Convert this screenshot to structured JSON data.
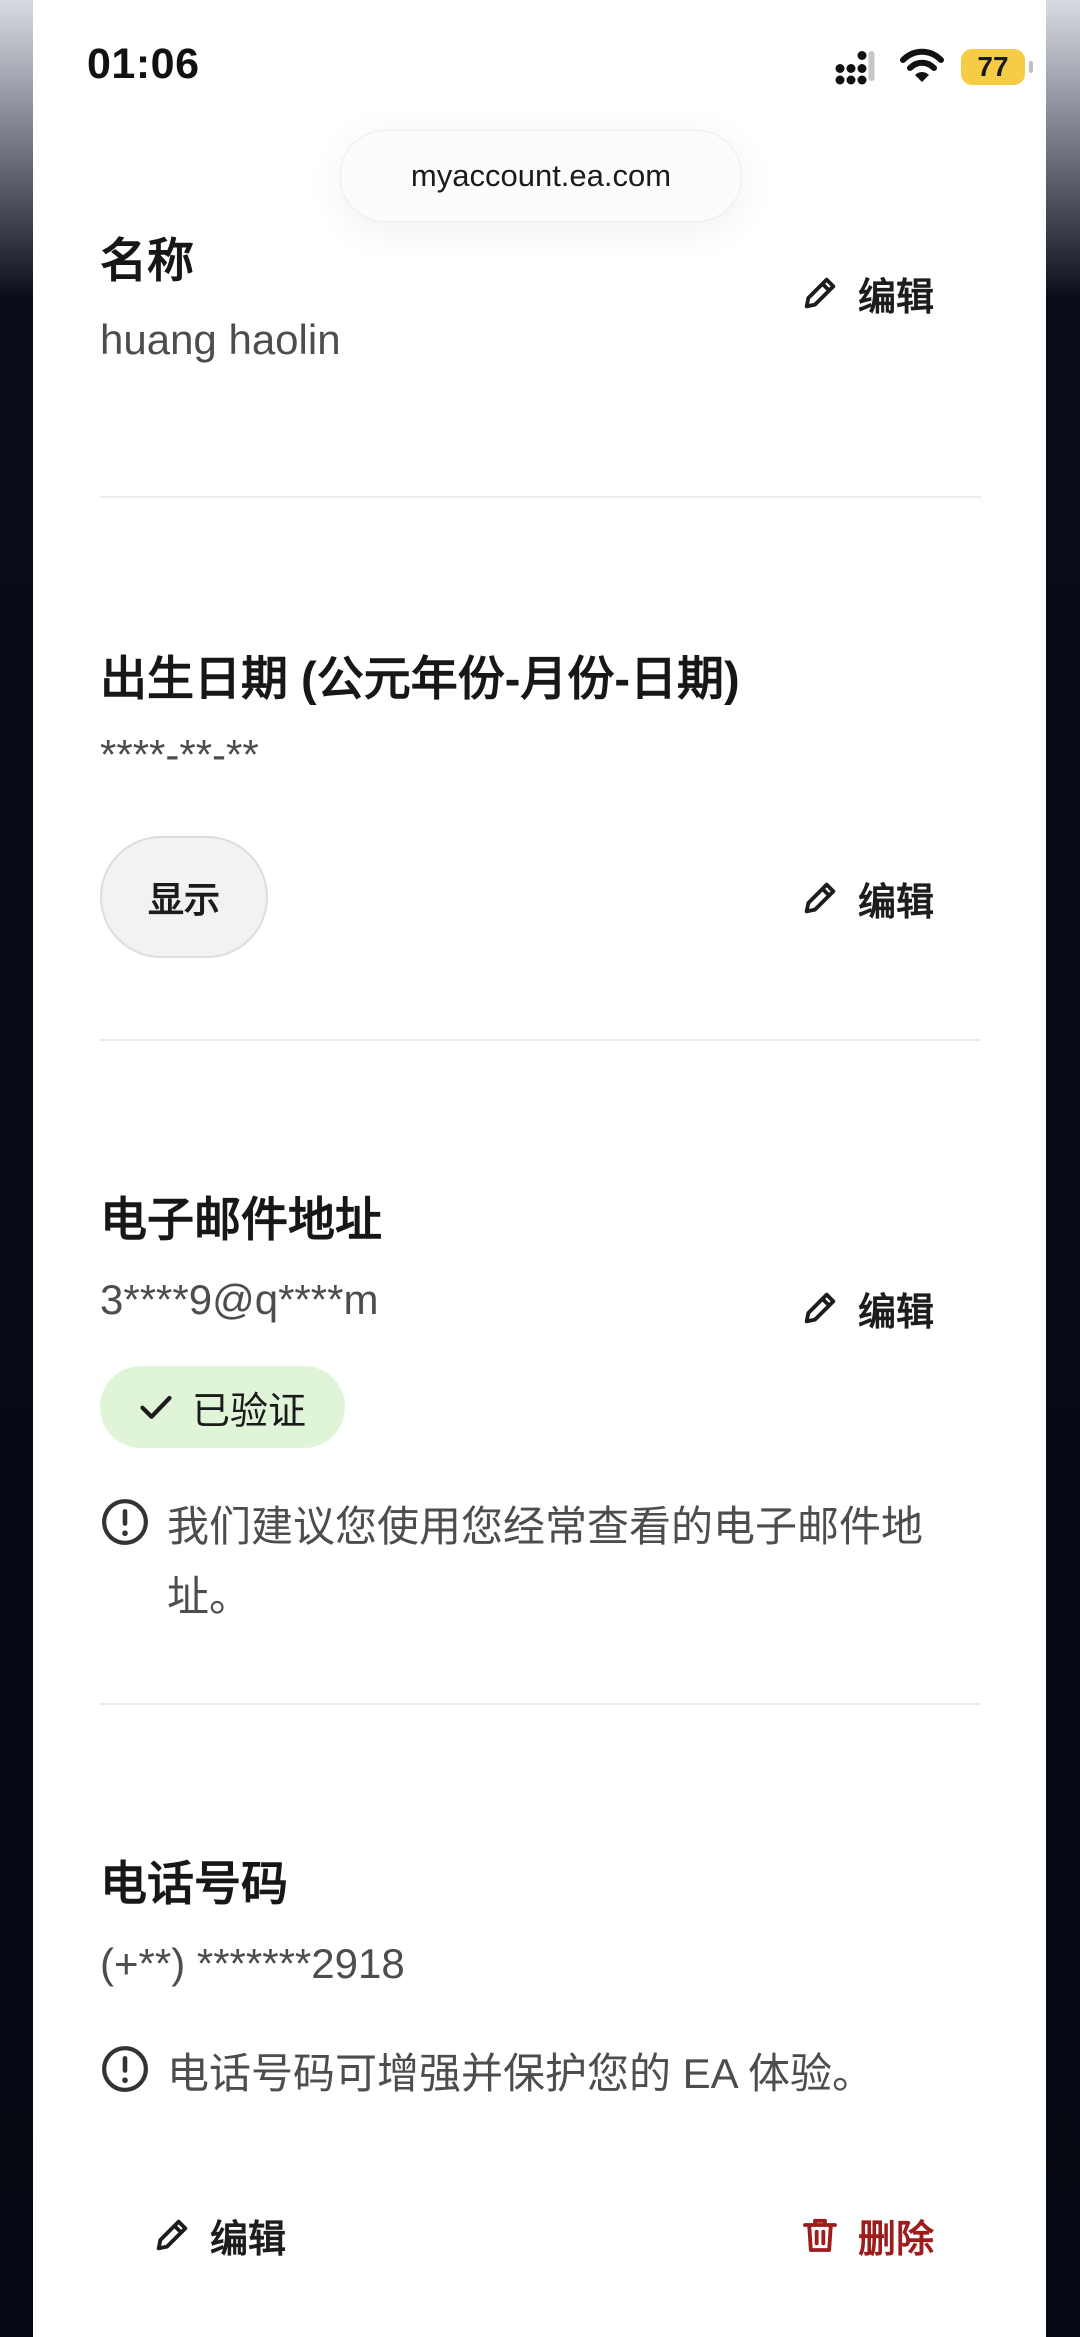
{
  "status_bar": {
    "time": "01:06",
    "battery_level": "77",
    "icons": [
      "signal-icon",
      "wifi-icon",
      "battery-icon"
    ]
  },
  "browser": {
    "url": "myaccount.ea.com"
  },
  "sections": {
    "name": {
      "title": "名称",
      "value": "huang haolin",
      "edit_label": "编辑"
    },
    "birth_date": {
      "title": "出生日期 (公元年份-月份-日期)",
      "value": "****-**-**",
      "show_label": "显示",
      "edit_label": "编辑"
    },
    "email": {
      "title": "电子邮件地址",
      "value": "3****9@q****m",
      "edit_label": "编辑",
      "verified_label": "已验证",
      "notice": "我们建议您使用您经常查看的电子邮件地址。"
    },
    "phone": {
      "title": "电话号码",
      "value": "(+**) *******2918",
      "notice": "电话号码可增强并保护您的 EA 体验。",
      "edit_label": "编辑",
      "delete_label": "删除"
    }
  },
  "colors": {
    "verified_bg": "#e0f4d8",
    "delete_red": "#9d1d1d",
    "battery_yellow": "#f5cc43"
  }
}
